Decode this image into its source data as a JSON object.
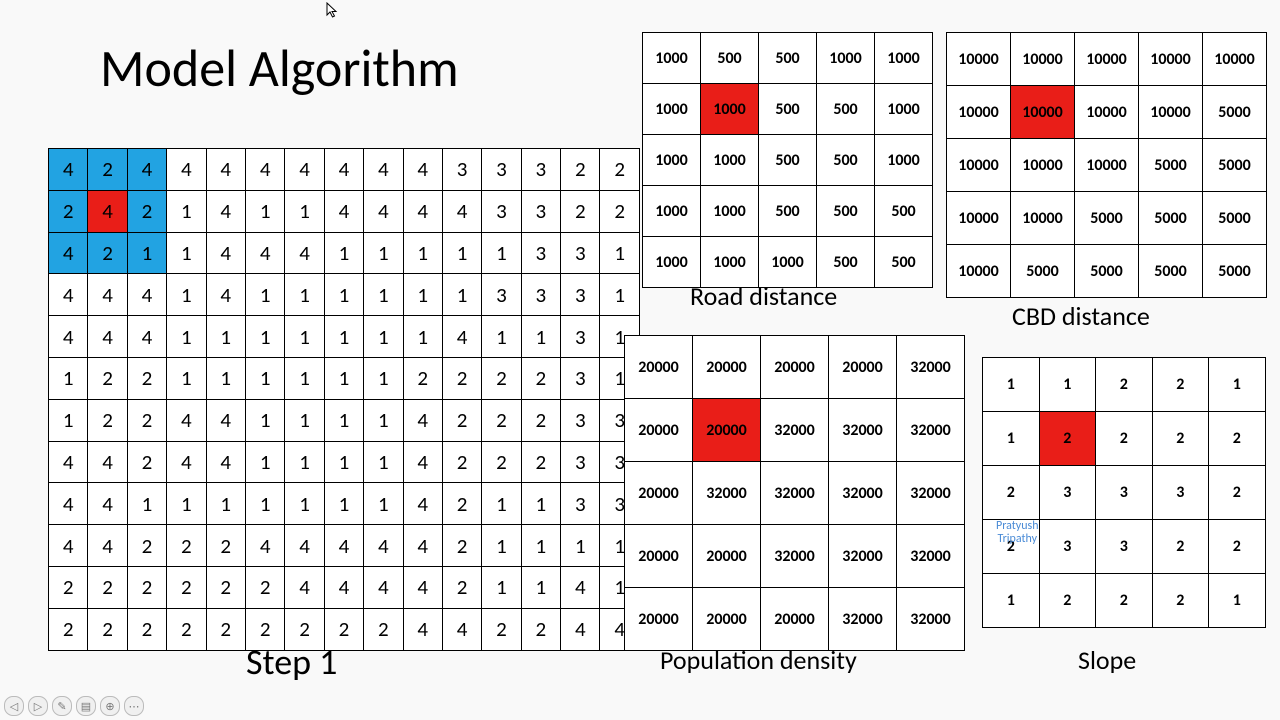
{
  "title": "Model Algorithm",
  "step_label": "Step 1",
  "watermark_line1": "Pratyush",
  "watermark_line2": "Tripathy",
  "big_grid": {
    "highlight_red": [
      [
        1,
        1
      ]
    ],
    "highlight_blue": [
      [
        0,
        0
      ],
      [
        0,
        1
      ],
      [
        0,
        2
      ],
      [
        1,
        0
      ],
      [
        1,
        2
      ],
      [
        2,
        0
      ],
      [
        2,
        1
      ],
      [
        2,
        2
      ]
    ],
    "rows": [
      [
        4,
        2,
        4,
        4,
        4,
        4,
        4,
        4,
        4,
        4,
        3,
        3,
        3,
        2,
        2
      ],
      [
        2,
        4,
        2,
        1,
        4,
        1,
        1,
        4,
        4,
        4,
        4,
        3,
        3,
        2,
        2
      ],
      [
        4,
        2,
        1,
        1,
        4,
        4,
        4,
        1,
        1,
        1,
        1,
        1,
        3,
        3,
        1
      ],
      [
        4,
        4,
        4,
        1,
        4,
        1,
        1,
        1,
        1,
        1,
        1,
        3,
        3,
        3,
        1
      ],
      [
        4,
        4,
        4,
        1,
        1,
        1,
        1,
        1,
        1,
        1,
        4,
        1,
        1,
        3,
        1
      ],
      [
        1,
        2,
        2,
        1,
        1,
        1,
        1,
        1,
        1,
        2,
        2,
        2,
        2,
        3,
        1
      ],
      [
        1,
        2,
        2,
        4,
        4,
        1,
        1,
        1,
        1,
        4,
        2,
        2,
        2,
        3,
        3
      ],
      [
        4,
        4,
        2,
        4,
        4,
        1,
        1,
        1,
        1,
        4,
        2,
        2,
        2,
        3,
        3
      ],
      [
        4,
        4,
        1,
        1,
        1,
        1,
        1,
        1,
        1,
        4,
        2,
        1,
        1,
        3,
        3
      ],
      [
        4,
        4,
        2,
        2,
        2,
        4,
        4,
        4,
        4,
        4,
        2,
        1,
        1,
        1,
        1
      ],
      [
        2,
        2,
        2,
        2,
        2,
        2,
        4,
        4,
        4,
        4,
        2,
        1,
        1,
        4,
        1
      ],
      [
        2,
        2,
        2,
        2,
        2,
        2,
        2,
        2,
        2,
        4,
        4,
        2,
        2,
        4,
        4
      ]
    ]
  },
  "road_grid": {
    "caption": "Road distance",
    "highlight_red": [
      [
        1,
        1
      ]
    ],
    "rows": [
      [
        1000,
        500,
        500,
        1000,
        1000
      ],
      [
        1000,
        1000,
        500,
        500,
        1000
      ],
      [
        1000,
        1000,
        500,
        500,
        1000
      ],
      [
        1000,
        1000,
        500,
        500,
        500
      ],
      [
        1000,
        1000,
        1000,
        500,
        500
      ]
    ]
  },
  "cbd_grid": {
    "caption": "CBD distance",
    "highlight_red": [
      [
        1,
        1
      ]
    ],
    "rows": [
      [
        10000,
        10000,
        10000,
        10000,
        10000
      ],
      [
        10000,
        10000,
        10000,
        10000,
        5000
      ],
      [
        10000,
        10000,
        10000,
        5000,
        5000
      ],
      [
        10000,
        10000,
        5000,
        5000,
        5000
      ],
      [
        10000,
        5000,
        5000,
        5000,
        5000
      ]
    ]
  },
  "pop_grid": {
    "caption": "Population density",
    "highlight_red": [
      [
        1,
        1
      ]
    ],
    "rows": [
      [
        20000,
        20000,
        20000,
        20000,
        32000
      ],
      [
        20000,
        20000,
        32000,
        32000,
        32000
      ],
      [
        20000,
        32000,
        32000,
        32000,
        32000
      ],
      [
        20000,
        20000,
        32000,
        32000,
        32000
      ],
      [
        20000,
        20000,
        20000,
        32000,
        32000
      ]
    ]
  },
  "slope_grid": {
    "caption": "Slope",
    "highlight_red": [
      [
        1,
        1
      ]
    ],
    "rows": [
      [
        1,
        1,
        2,
        2,
        1
      ],
      [
        1,
        2,
        2,
        2,
        2
      ],
      [
        2,
        3,
        3,
        3,
        2
      ],
      [
        2,
        3,
        3,
        2,
        2
      ],
      [
        1,
        2,
        2,
        2,
        1
      ]
    ]
  },
  "toolbar": {
    "prev": "◁",
    "next": "▷",
    "anim": "✎",
    "menu": "▤",
    "zoom": "⊕",
    "more": "⋯"
  }
}
